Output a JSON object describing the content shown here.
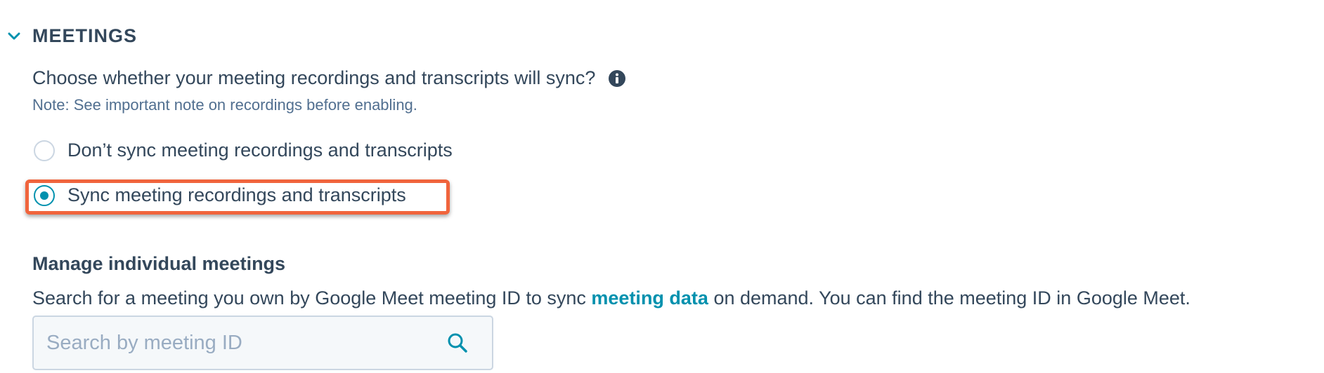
{
  "section": {
    "title": "MEETINGS",
    "chevron_icon": "chevron-down-icon"
  },
  "sync_setting": {
    "question": "Choose whether your meeting recordings and transcripts will sync?",
    "info_icon": "info-icon",
    "note": "Note: See important note on recordings before enabling.",
    "options": [
      {
        "label": "Don’t sync meeting recordings and transcripts",
        "selected": false
      },
      {
        "label": "Sync meeting recordings and transcripts",
        "selected": true
      }
    ]
  },
  "manage": {
    "heading": "Manage individual meetings",
    "description_before": "Search for a meeting you own by Google Meet meeting ID to sync ",
    "description_link": "meeting data",
    "description_after": " on demand. You can find the meeting ID in Google Meet.",
    "search_placeholder": "Search by meeting ID",
    "search_value": ""
  },
  "colors": {
    "text": "#33475b",
    "link": "#0091ae",
    "highlight": "#f0643c",
    "placeholder": "#99acc2"
  }
}
